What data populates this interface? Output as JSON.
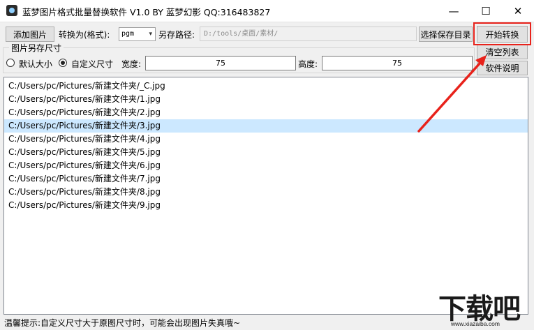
{
  "window": {
    "title": "蓝梦图片格式批量替换软件 V1.0 BY 蓝梦幻影 QQ:316483827",
    "minimize_glyph": "—",
    "maximize_glyph": "☐",
    "close_glyph": "✕"
  },
  "toolbar": {
    "add_images_label": "添加图片",
    "convert_to_label": "转换为(格式):",
    "format_value": "pgm",
    "save_path_label": "另存路径:",
    "save_path_value": "D:/tools/桌面/素材/",
    "choose_dir_label": "选择保存目录",
    "start_convert_label": "开始转换",
    "clear_list_label": "清空列表",
    "help_label": "软件说明"
  },
  "size_group": {
    "legend": "图片另存尺寸",
    "default_size_label": "默认大小",
    "custom_size_label": "自定义尺寸",
    "custom_selected": true,
    "width_label": "宽度:",
    "width_value": "75",
    "height_label": "高度:",
    "height_value": "75"
  },
  "files": [
    "C:/Users/pc/Pictures/新建文件夹/_C.jpg",
    "C:/Users/pc/Pictures/新建文件夹/1.jpg",
    "C:/Users/pc/Pictures/新建文件夹/2.jpg",
    "C:/Users/pc/Pictures/新建文件夹/3.jpg",
    "C:/Users/pc/Pictures/新建文件夹/4.jpg",
    "C:/Users/pc/Pictures/新建文件夹/5.jpg",
    "C:/Users/pc/Pictures/新建文件夹/6.jpg",
    "C:/Users/pc/Pictures/新建文件夹/7.jpg",
    "C:/Users/pc/Pictures/新建文件夹/8.jpg",
    "C:/Users/pc/Pictures/新建文件夹/9.jpg"
  ],
  "selected_file_index": 3,
  "status": {
    "tip": "温馨提示:自定义尺寸大于原图尺寸时，可能会出现图片失真哦~"
  },
  "watermark": {
    "logo_text": "下载吧",
    "url_text": "www.xiazaiba.com"
  },
  "colors": {
    "selection": "#cce8ff",
    "annotation_red": "#e8221b"
  }
}
